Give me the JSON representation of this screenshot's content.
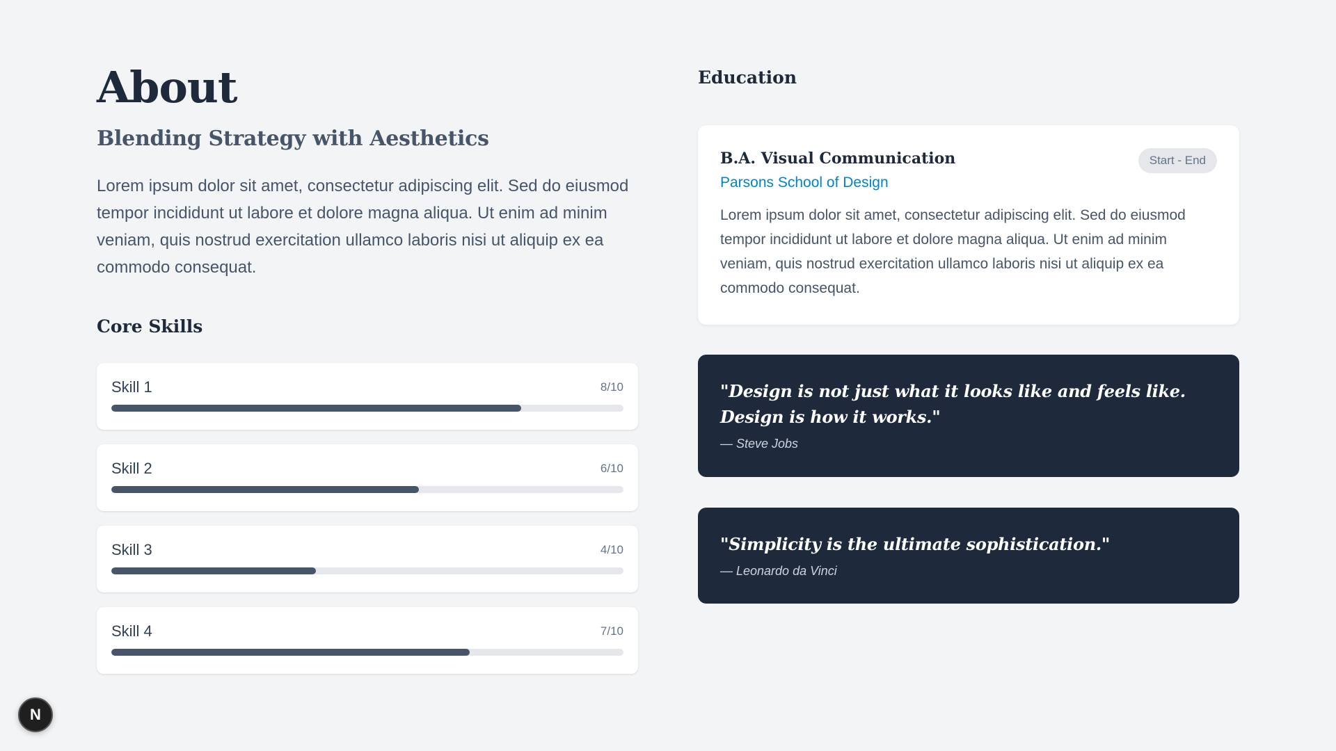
{
  "about": {
    "title": "About",
    "subtitle": "Blending Strategy with Aesthetics",
    "body": "Lorem ipsum dolor sit amet, consectetur adipiscing elit. Sed do eiusmod tempor incididunt ut labore et dolore magna aliqua. Ut enim ad minim veniam, quis nostrud exercitation ullamco laboris nisi ut aliquip ex ea commodo consequat."
  },
  "skills": {
    "heading": "Core Skills",
    "items": [
      {
        "name": "Skill 1",
        "score_label": "8/10",
        "level": 8
      },
      {
        "name": "Skill 2",
        "score_label": "6/10",
        "level": 6
      },
      {
        "name": "Skill 3",
        "score_label": "4/10",
        "level": 4
      },
      {
        "name": "Skill 4",
        "score_label": "7/10",
        "level": 7
      }
    ],
    "max": 10
  },
  "education": {
    "heading": "Education",
    "degree": "B.A. Visual Communication",
    "dates": "Start - End",
    "school": "Parsons School of Design",
    "description": "Lorem ipsum dolor sit amet, consectetur adipiscing elit. Sed do eiusmod tempor incididunt ut labore et dolore magna aliqua. Ut enim ad minim veniam, quis nostrud exercitation ullamco laboris nisi ut aliquip ex ea commodo consequat."
  },
  "quotes": [
    {
      "text": "\"Design is not just what it looks like and feels like. Design is how it works.\"",
      "author": "— Steve Jobs"
    },
    {
      "text": "\"Simplicity is the ultimate sophistication.\"",
      "author": "— Leonardo da Vinci"
    }
  ],
  "badge": {
    "letter": "N",
    "icon": "nextjs-logo-icon"
  },
  "colors": {
    "background": "#f3f4f6",
    "heading": "#1e293b",
    "link": "#0284c7",
    "bar_fill": "#475569",
    "bar_track": "#e5e7eb",
    "quote_bg": "#1e293b"
  }
}
